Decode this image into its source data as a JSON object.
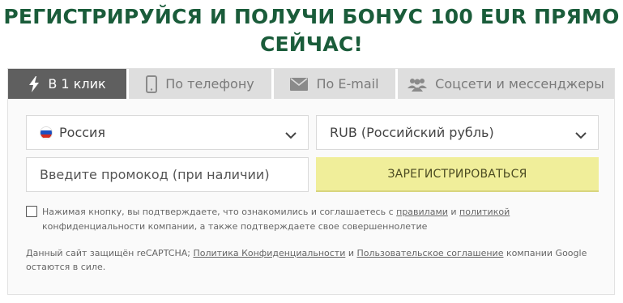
{
  "headline": {
    "line1": "РЕГИСТРИРУЙСЯ И ПОЛУЧИ БОНУС 100 EUR ПРЯМО",
    "line2": "СЕЙЧАС!"
  },
  "tabs": [
    {
      "label": "В 1 клик",
      "icon": "lightning-icon",
      "active": true
    },
    {
      "label": "По телефону",
      "icon": "phone-icon",
      "active": false
    },
    {
      "label": "По E-mail",
      "icon": "envelope-icon",
      "active": false
    },
    {
      "label": "Соцсети и мессенджеры",
      "icon": "users-icon",
      "active": false
    }
  ],
  "form": {
    "country": {
      "value": "Россия",
      "icon": "russia-flag-icon"
    },
    "currency": {
      "value": "RUB (Российский рубль)"
    },
    "promo": {
      "placeholder": "Введите промокод (при наличии)",
      "value": ""
    },
    "register_label": "ЗАРЕГИСТРИРОВАТЬСЯ"
  },
  "consent": {
    "text1": "Нажимая кнопку, вы подтверждаете, что ознакомились и соглашаетесь с ",
    "link1": "правилами",
    "text2": " и ",
    "link2": "политикой",
    "text3": " конфиденциальности компании, а также подтверждаете свое совершеннолетие",
    "checked": false
  },
  "recaptcha": {
    "text1": "Данный сайт защищён reCAPTCHA; ",
    "link1": "Политика Конфиденциальности",
    "text2": " и ",
    "link2": "Пользовательское соглашение",
    "text3": " компании Google остаются в силе."
  },
  "colors": {
    "headline": "#1a5c3a",
    "tab_active_bg": "#5f5f5f",
    "tab_inactive_bg": "#dedede",
    "register_bg": "#f0ee9a"
  }
}
